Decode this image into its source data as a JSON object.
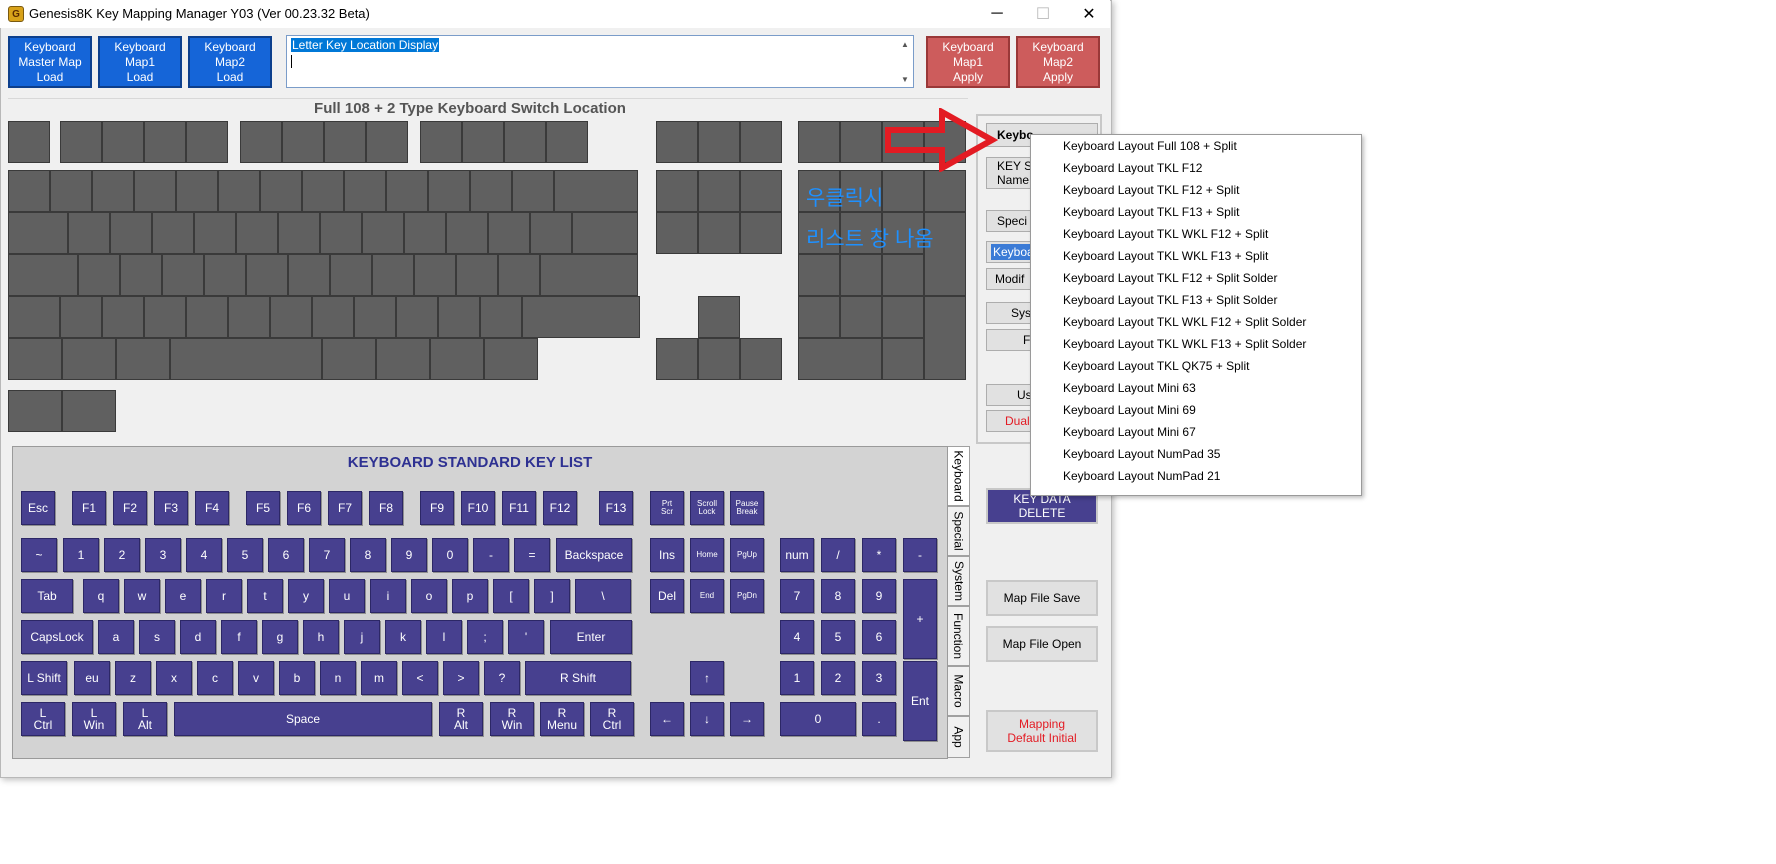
{
  "window": {
    "title": "Genesis8K Key Mapping Manager Y03 (Ver 00.23.32 Beta)",
    "app_icon_glyph": "G",
    "minimize_glyph": "─",
    "maximize_glyph": "☐",
    "close_glyph": "✕"
  },
  "toolbar": {
    "load_buttons": [
      "Keyboard\nMaster Map\nLoad",
      "Keyboard\nMap1\nLoad",
      "Keyboard\nMap2\nLoad"
    ],
    "apply_buttons": [
      "Keyboard\nMap1\nApply",
      "Keyboard\nMap2\nApply"
    ],
    "letter_display_text": "Letter Key Location Display"
  },
  "layout_title": "Full 108 + 2 Type Keyboard Switch Location",
  "standard_panel": {
    "title": "KEYBOARD STANDARD KEY LIST",
    "tabs": [
      "Keyboard",
      "Special",
      "System",
      "Function",
      "Macro",
      "App"
    ]
  },
  "side_panel": {
    "layout_combo": "Keybo",
    "key_switch_name": "KEY Sv\nName",
    "special": "Speci",
    "keyboard_sel": "Keyboa",
    "modifier": "Modif",
    "system": "Syst",
    "f": "F",
    "user": "Us",
    "dual": "Dual",
    "key_data_delete": "KEY DATA\nDELETE",
    "map_file_save": "Map File Save",
    "map_file_open": "Map File Open",
    "mapping_default": "Mapping\nDefault Initial"
  },
  "dropdown": {
    "items": [
      "Keyboard Layout Full 108 + Split",
      "Keyboard Layout TKL F12",
      "Keyboard Layout TKL F12 + Split",
      "Keyboard Layout TKL F13 + Split",
      "Keyboard Layout TKL WKL F12 + Split",
      "Keyboard Layout TKL WKL F13 + Split",
      "Keyboard Layout TKL F12 + Split Solder",
      "Keyboard Layout TKL F13 + Split Solder",
      "Keyboard Layout TKL WKL F12 + Split Solder",
      "Keyboard Layout TKL WKL F13 + Split Solder",
      "Keyboard Layout TKL QK75 + Split",
      "Keyboard Layout Mini 63",
      "Keyboard Layout Mini 69",
      "Keyboard Layout Mini 67",
      "Keyboard Layout NumPad 35",
      "Keyboard Layout NumPad 21"
    ]
  },
  "annotation": {
    "line1": "우클릭시",
    "line2": "리스트 창 나옴",
    "color": "#1e90ff",
    "arrow_color": "#e31b23"
  },
  "colors": {
    "blue_button": "#1565d8",
    "red_button": "#cd5c5c",
    "key_slot": "#606060",
    "standard_key": "#47408f",
    "standard_title": "#2e3192",
    "danger_text": "#e31b23"
  },
  "standard_keys": [
    {
      "label": "Esc"
    },
    {
      "label": "F1"
    },
    {
      "label": "F2"
    },
    {
      "label": "F3"
    },
    {
      "label": "F4"
    },
    {
      "label": "F5"
    },
    {
      "label": "F6"
    },
    {
      "label": "F7"
    },
    {
      "label": "F8"
    },
    {
      "label": "F9"
    },
    {
      "label": "F10"
    },
    {
      "label": "F11"
    },
    {
      "label": "F12"
    },
    {
      "label": "F13"
    },
    {
      "label": "Prt\nScr"
    },
    {
      "label": "Scroll\nLock"
    },
    {
      "label": "Pause\nBreak"
    },
    {
      "label": "~"
    },
    {
      "label": "1"
    },
    {
      "label": "2"
    },
    {
      "label": "3"
    },
    {
      "label": "4"
    },
    {
      "label": "5"
    },
    {
      "label": "6"
    },
    {
      "label": "7"
    },
    {
      "label": "8"
    },
    {
      "label": "9"
    },
    {
      "label": "0"
    },
    {
      "label": "-"
    },
    {
      "label": "="
    },
    {
      "label": "Backspace"
    },
    {
      "label": "Ins"
    },
    {
      "label": "Home"
    },
    {
      "label": "PgUp"
    },
    {
      "label": "num"
    },
    {
      "label": "/"
    },
    {
      "label": "*"
    },
    {
      "label": "-"
    },
    {
      "label": "Tab"
    },
    {
      "label": "q"
    },
    {
      "label": "w"
    },
    {
      "label": "e"
    },
    {
      "label": "r"
    },
    {
      "label": "t"
    },
    {
      "label": "y"
    },
    {
      "label": "u"
    },
    {
      "label": "i"
    },
    {
      "label": "o"
    },
    {
      "label": "p"
    },
    {
      "label": "["
    },
    {
      "label": "]"
    },
    {
      "label": "\\"
    },
    {
      "label": "Del"
    },
    {
      "label": "End"
    },
    {
      "label": "PgDn"
    },
    {
      "label": "7"
    },
    {
      "label": "8"
    },
    {
      "label": "9"
    },
    {
      "label": "+"
    },
    {
      "label": "CapsLock"
    },
    {
      "label": "a"
    },
    {
      "label": "s"
    },
    {
      "label": "d"
    },
    {
      "label": "f"
    },
    {
      "label": "g"
    },
    {
      "label": "h"
    },
    {
      "label": "j"
    },
    {
      "label": "k"
    },
    {
      "label": "l"
    },
    {
      "label": ";"
    },
    {
      "label": "'"
    },
    {
      "label": "Enter"
    },
    {
      "label": "4"
    },
    {
      "label": "5"
    },
    {
      "label": "6"
    },
    {
      "label": "L Shift"
    },
    {
      "label": "eu"
    },
    {
      "label": "z"
    },
    {
      "label": "x"
    },
    {
      "label": "c"
    },
    {
      "label": "v"
    },
    {
      "label": "b"
    },
    {
      "label": "n"
    },
    {
      "label": "m"
    },
    {
      "label": "<"
    },
    {
      "label": ">"
    },
    {
      "label": "?"
    },
    {
      "label": "R Shift"
    },
    {
      "label": "↑"
    },
    {
      "label": "1"
    },
    {
      "label": "2"
    },
    {
      "label": "3"
    },
    {
      "label": "Ent"
    },
    {
      "label": "L\nCtrl"
    },
    {
      "label": "L\nWin"
    },
    {
      "label": "L\nAlt"
    },
    {
      "label": "Space"
    },
    {
      "label": "R\nAlt"
    },
    {
      "label": "R\nWin"
    },
    {
      "label": "R\nMenu"
    },
    {
      "label": "R\nCtrl"
    },
    {
      "label": "←"
    },
    {
      "label": "↓"
    },
    {
      "label": "→"
    },
    {
      "label": "0"
    },
    {
      "label": "."
    }
  ]
}
